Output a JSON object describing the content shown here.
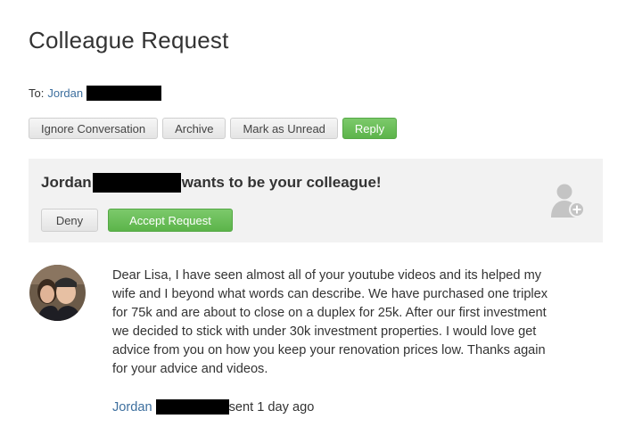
{
  "header": {
    "title": "Colleague Request"
  },
  "recipient": {
    "label": "To:",
    "name": "Jordan"
  },
  "toolbar": {
    "ignore_label": "Ignore Conversation",
    "archive_label": "Archive",
    "mark_unread_label": "Mark as Unread",
    "reply_label": "Reply"
  },
  "request": {
    "requester_name": "Jordan",
    "message": "wants to be your colleague!",
    "deny_label": "Deny",
    "accept_label": "Accept Request",
    "icon": "add-user-icon"
  },
  "message": {
    "body": "Dear Lisa, I have seen almost all of your youtube videos and its helped my wife and I beyond what words can describe. We have purchased one triplex for 75k and are about to close on a duplex for 25k. After our first investment we decided to stick with under 30k investment properties. I would love get advice from you on how you keep your renovation prices low. Thanks again for your advice and videos.",
    "sender_name": "Jordan",
    "sent_time": "sent 1 day ago"
  },
  "colors": {
    "accent_green": "#5cb44a",
    "link_blue": "#3d6f9e",
    "box_bg": "#f2f2f2"
  }
}
